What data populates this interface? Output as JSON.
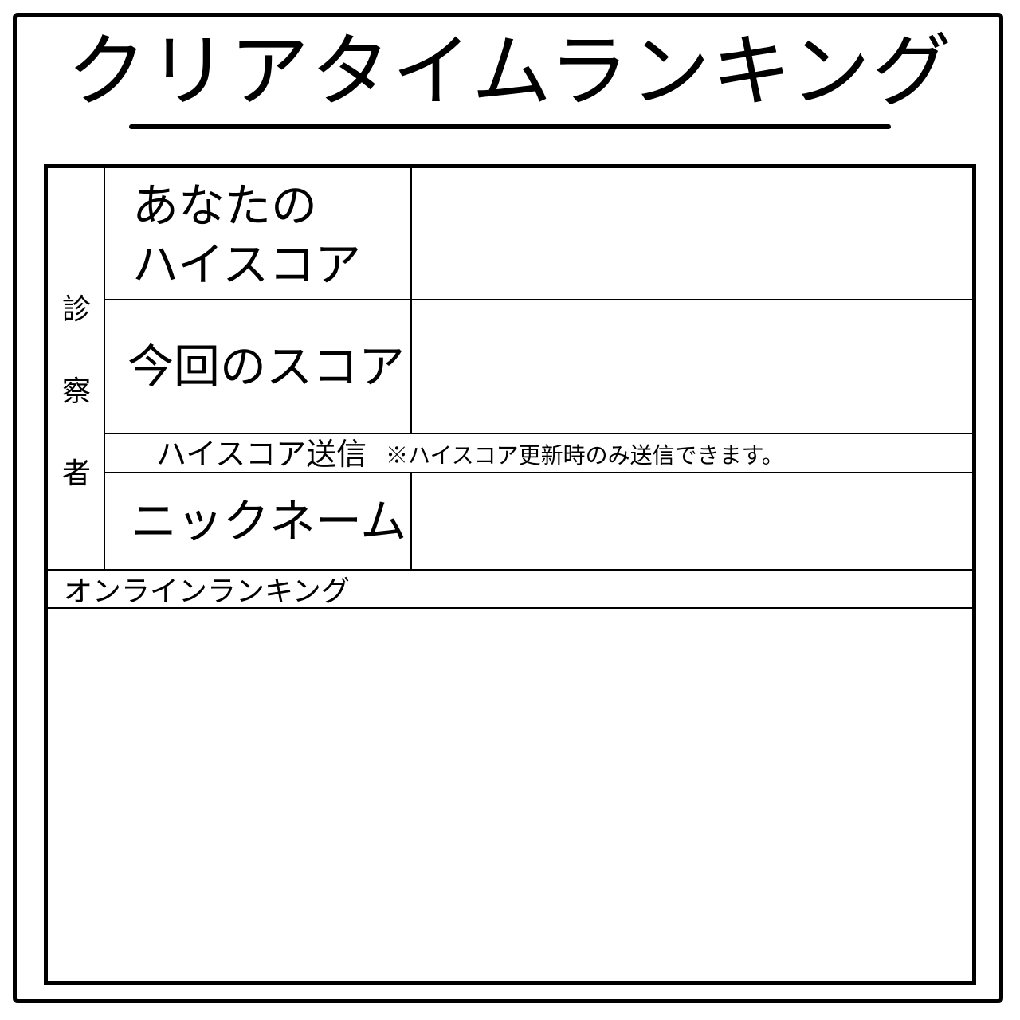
{
  "title": "クリアタイムランキング",
  "side_label": [
    "診",
    "察",
    "者"
  ],
  "rows": {
    "high_score_label_line1": "あなたの",
    "high_score_label_line2": "ハイスコア",
    "high_score_value": "",
    "current_score_label": "今回のスコア",
    "current_score_value": "",
    "send_button_label": "ハイスコア送信",
    "send_note": "※ハイスコア更新時のみ送信できます。",
    "nickname_label": "ニックネーム",
    "nickname_value": ""
  },
  "online_ranking": {
    "label": "オンラインランキング",
    "entries": []
  }
}
